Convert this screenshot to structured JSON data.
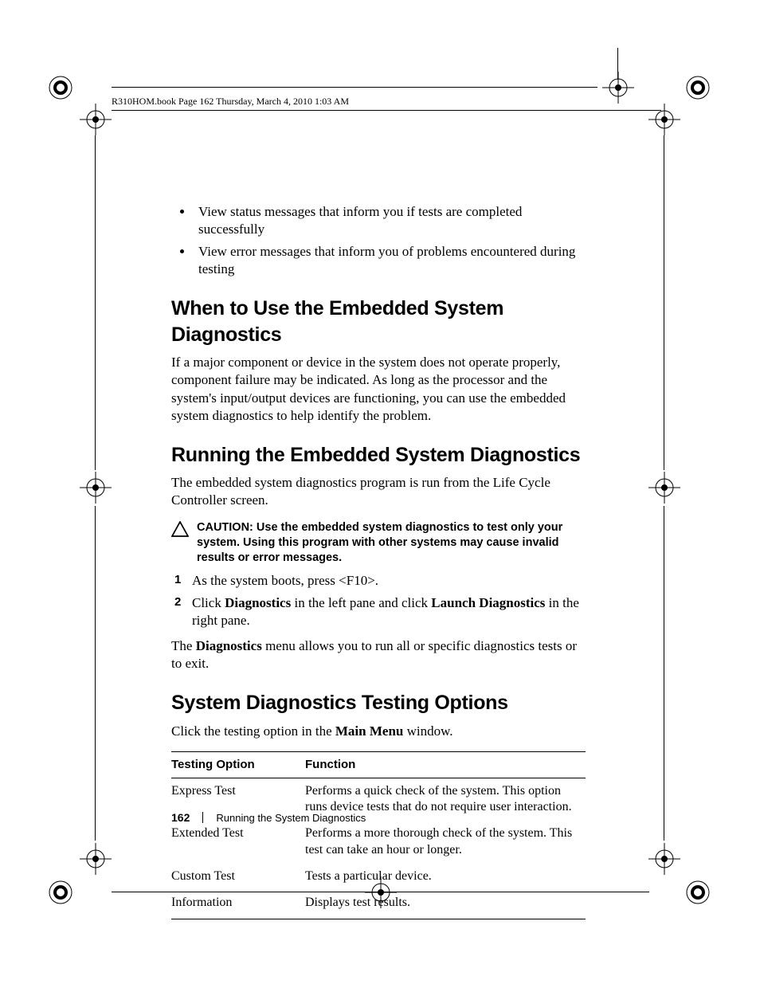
{
  "header": {
    "text": "R310HOM.book  Page 162  Thursday, March 4, 2010  1:03 AM"
  },
  "bullets": [
    "View status messages that inform you if tests are completed successfully",
    "View error messages that inform you of problems encountered during testing"
  ],
  "sections": {
    "when": {
      "heading": "When to Use the Embedded System Diagnostics",
      "body": "If a major component or device in the system does not operate properly, component failure may be indicated. As long as the processor and the system's input/output devices are functioning, you can use the embedded system diagnostics to help identify the problem."
    },
    "running": {
      "heading": "Running the Embedded System Diagnostics",
      "intro": "The embedded system diagnostics program is run from the Life Cycle Controller screen.",
      "caution_label": "CAUTION: ",
      "caution_text": "Use the embedded system diagnostics to test only your system. Using this program with other systems may cause invalid results or error messages.",
      "steps": [
        {
          "n": "1",
          "pre": "As the system boots, press <F10>."
        },
        {
          "n": "2",
          "pre": "Click ",
          "b1": "Diagnostics",
          "mid": " in the left pane and click ",
          "b2": "Launch Diagnostics",
          "post": " in the right pane."
        }
      ],
      "after_pre": "The ",
      "after_b": "Diagnostics",
      "after_post": " menu allows you to run all or specific diagnostics tests or to exit."
    },
    "options": {
      "heading": "System Diagnostics Testing Options",
      "intro_pre": "Click the testing option in the ",
      "intro_b": "Main Menu",
      "intro_post": " window.",
      "th1": "Testing Option",
      "th2": "Function",
      "rows": [
        {
          "opt": "Express Test",
          "func": "Performs a quick check of the system. This option runs device tests that do not require user interaction."
        },
        {
          "opt": "Extended Test",
          "func": "Performs a more thorough check of the system. This test can take an hour or longer."
        },
        {
          "opt": "Custom Test",
          "func": "Tests a particular device."
        },
        {
          "opt": "Information",
          "func": "Displays test results."
        }
      ]
    }
  },
  "footer": {
    "page": "162",
    "label": "Running the System Diagnostics"
  }
}
